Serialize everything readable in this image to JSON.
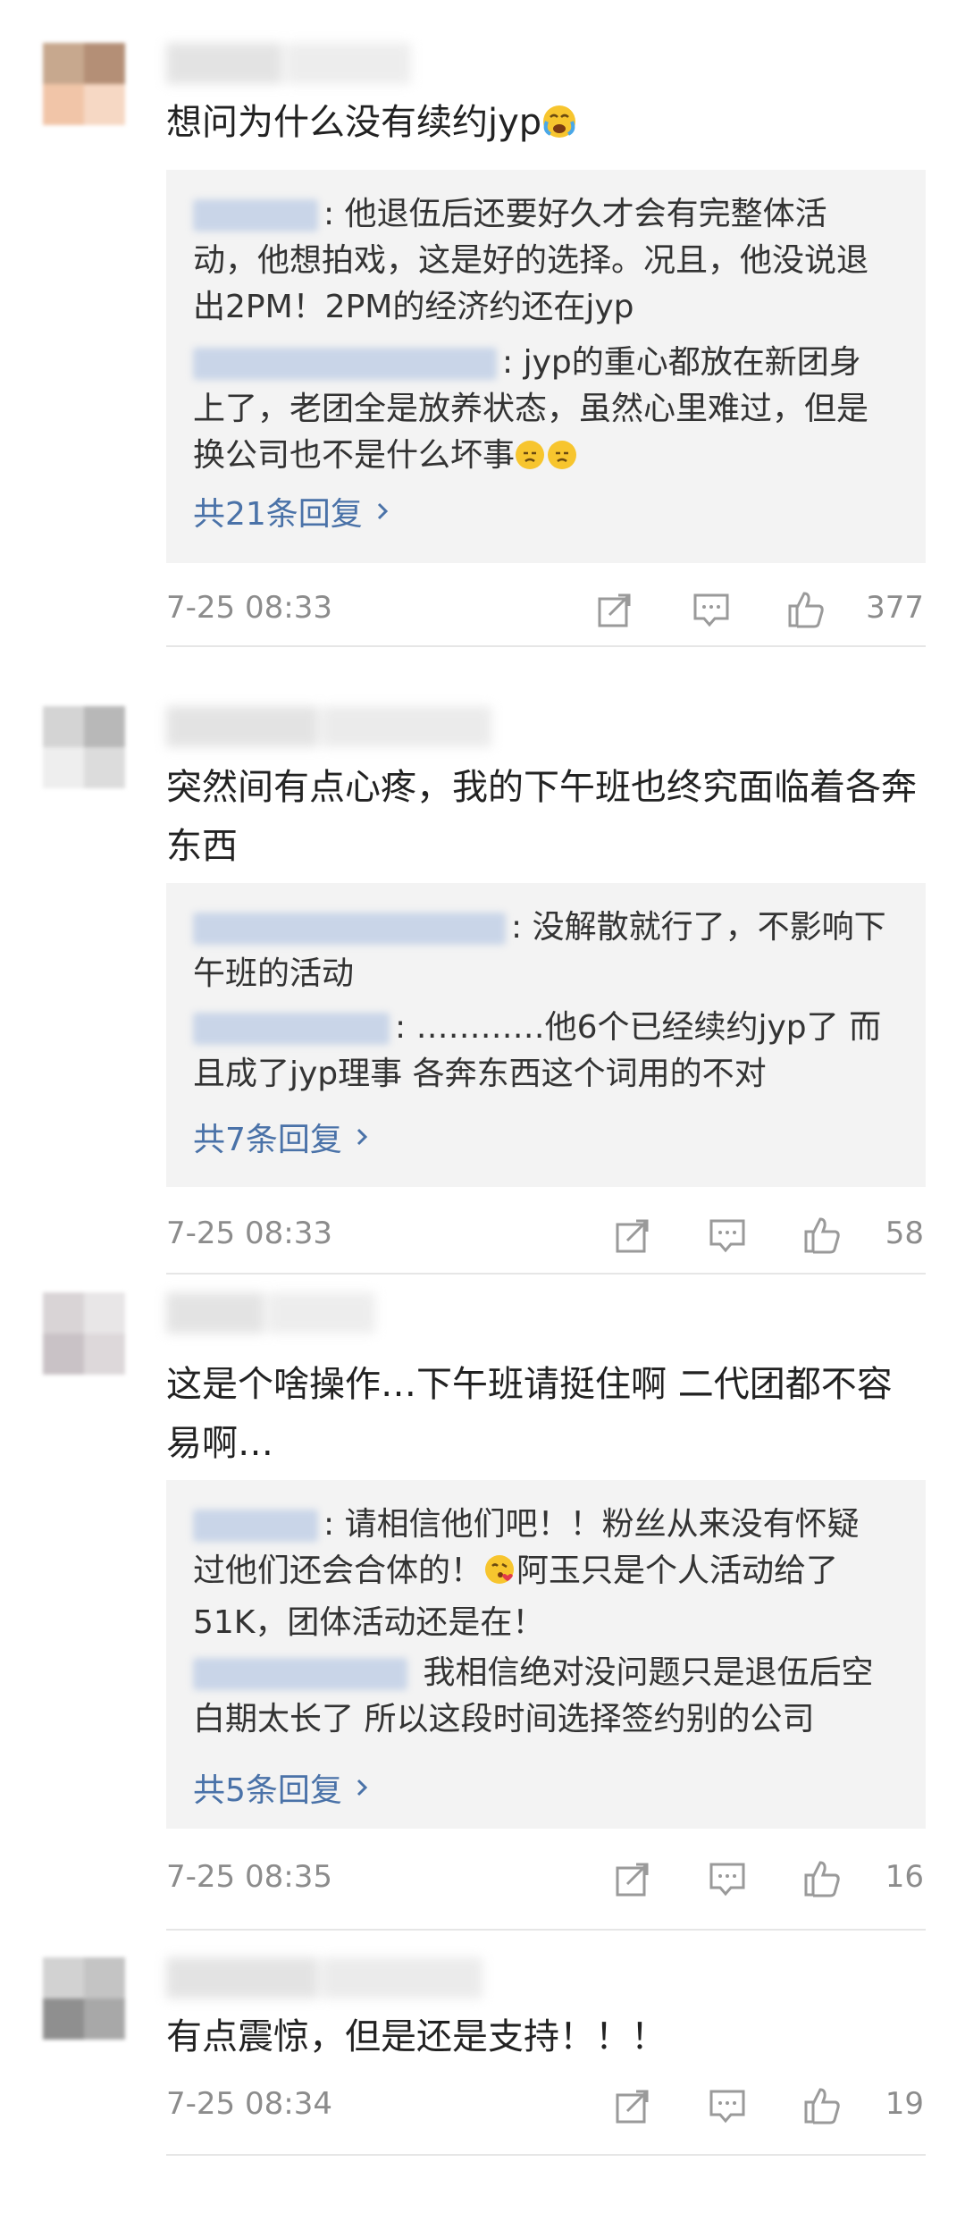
{
  "comments": [
    {
      "text": "想问为什么没有续约jyp",
      "replies": [
        {
          "text": ": 他退伍后还要好久才会有完整体活动，他想拍戏，这是好的选择。况且，他没说退出2PM！2PM的经济约还在jyp"
        },
        {
          "text": ": jyp的重心都放在新团身上了，老团全是放养状态，虽然心里难过，但是换公司也不是什么坏事"
        }
      ],
      "more": "共21条回复",
      "time": "7-25 08:33",
      "likes": "377"
    },
    {
      "text": "突然间有点心疼，我的下午班也终究面临着各奔东西",
      "replies": [
        {
          "text": ": 没解散就行了，不影响下午班的活动"
        },
        {
          "text": ": …………他6个已经续约jyp了 而且成了jyp理事 各奔东西这个词用的不对"
        }
      ],
      "more": "共7条回复",
      "time": "7-25 08:33",
      "likes": "58"
    },
    {
      "text": "这是个啥操作…下午班请挺住啊 二代团都不容易啊…",
      "replies": [
        {
          "text": ": 请相信他们吧！！粉丝从来没有怀疑过他们还会合体的！",
          "text_b": "阿玉只是个人活动给了51K，团体活动还是在！"
        },
        {
          "text": " 我相信绝对没问题只是退伍后空白期太长了 所以这段时间选择签约别的公司"
        }
      ],
      "more": "共5条回复",
      "time": "7-25 08:35",
      "likes": "16"
    },
    {
      "text": "有点震惊，但是还是支持！！！",
      "time": "7-25 08:34",
      "likes": "19"
    }
  ],
  "icons": [
    "repost-icon",
    "comment-icon",
    "like-icon",
    "chevron-right-icon"
  ]
}
